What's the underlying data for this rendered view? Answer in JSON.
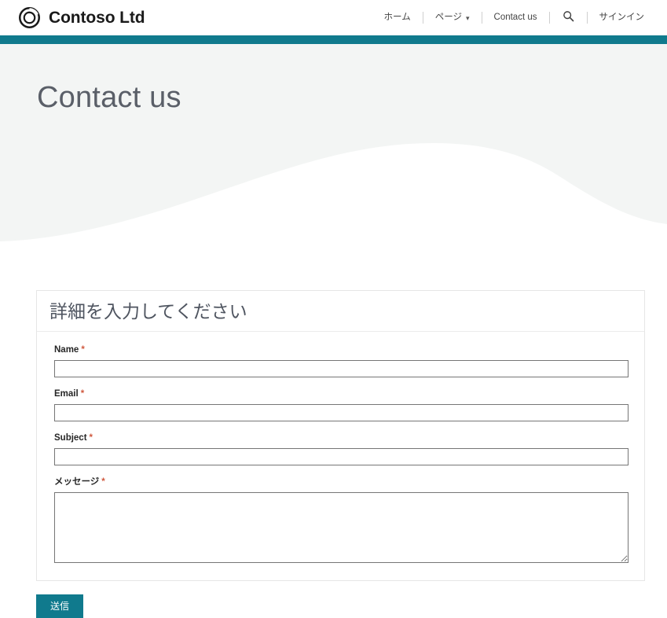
{
  "site": {
    "brand_name": "Contoso Ltd",
    "logo_icon": "contoso-ring-logo",
    "accent_color": "#107a8d",
    "hero_bg_color": "#f3f5f4"
  },
  "nav": {
    "items": [
      {
        "label": "ホーム",
        "icon": null,
        "has_caret": false
      },
      {
        "label": "ページ",
        "icon": "chevron-down-icon",
        "has_caret": true
      },
      {
        "label": "Contact us",
        "icon": null,
        "has_caret": false
      }
    ],
    "search_icon": "search-icon",
    "sign_in_label": "サインイン"
  },
  "hero": {
    "title": "Contact us"
  },
  "form": {
    "title": "詳細を入力してください",
    "required_marker": "*",
    "fields": [
      {
        "label": "Name",
        "required": true,
        "value": "",
        "placeholder": "",
        "type": "text"
      },
      {
        "label": "Email",
        "required": true,
        "value": "",
        "placeholder": "",
        "type": "text"
      },
      {
        "label": "Subject",
        "required": true,
        "value": "",
        "placeholder": "",
        "type": "text"
      },
      {
        "label": "メッセージ",
        "required": true,
        "value": "",
        "placeholder": "",
        "type": "textarea"
      }
    ],
    "submit_label": "送信"
  }
}
